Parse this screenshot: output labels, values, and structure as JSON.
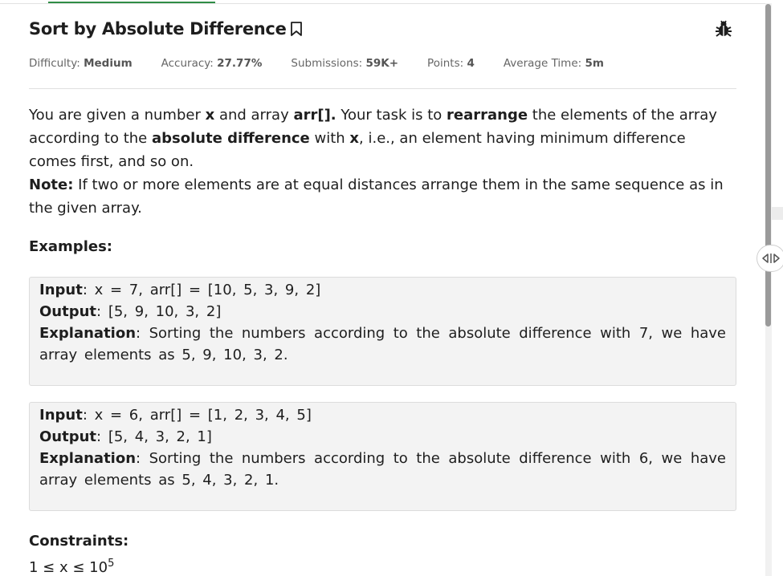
{
  "problem": {
    "title": "Sort by Absolute Difference",
    "meta": [
      {
        "label": "Difficulty: ",
        "value": "Medium"
      },
      {
        "label": "Accuracy: ",
        "value": "27.77%"
      },
      {
        "label": "Submissions: ",
        "value": "59K+"
      },
      {
        "label": "Points: ",
        "value": "4"
      },
      {
        "label": "Average Time: ",
        "value": "5m"
      }
    ],
    "statement": {
      "p1": "You are given a number ",
      "p1_b1": "x",
      "p2": " and array ",
      "p2_b": "arr[].",
      "p3": " Your task is to ",
      "p3_b": "rearrange",
      "p4": " the elements of the array according to the ",
      "p4_b": "absolute difference",
      "p5": " with ",
      "p5_b": "x",
      "p6": ", i.e., an element having minimum difference comes first, and so on.",
      "note_label": "Note:",
      "note_text": " If two or more elements are at equal distances arrange them in the same sequence as in the given array."
    },
    "examples_heading": "Examples:",
    "examples": [
      {
        "input_label": "Input",
        "input": ": x = 7, arr[] = [10, 5, 3, 9, 2]",
        "output_label": "Output",
        "output": ": [5, 9, 10, 3, 2]",
        "explanation_label": "Explanation",
        "explanation": ": Sorting the numbers according to the absolute difference with 7, we have array elements as 5, 9, 10, 3, 2."
      },
      {
        "input_label": "Input",
        "input": ": x = 6, arr[] = [1, 2, 3, 4, 5]",
        "output_label": "Output",
        "output": ": [5, 4, 3, 2, 1]",
        "explanation_label": "Explanation",
        "explanation": ": Sorting the numbers according to the absolute difference with 6, we have array elements as 5, 4, 3, 2, 1."
      }
    ],
    "constraints_heading": "Constraints:",
    "constraint_1": "1 ≤ x ≤ 10",
    "constraint_1_exp": "5"
  },
  "icons": {
    "bookmark": "bookmark-icon",
    "report": "bug-icon",
    "resize": "panel-resize-icon"
  },
  "colors": {
    "accent": "#2f8d46",
    "example_bg": "#f3f3f3"
  }
}
